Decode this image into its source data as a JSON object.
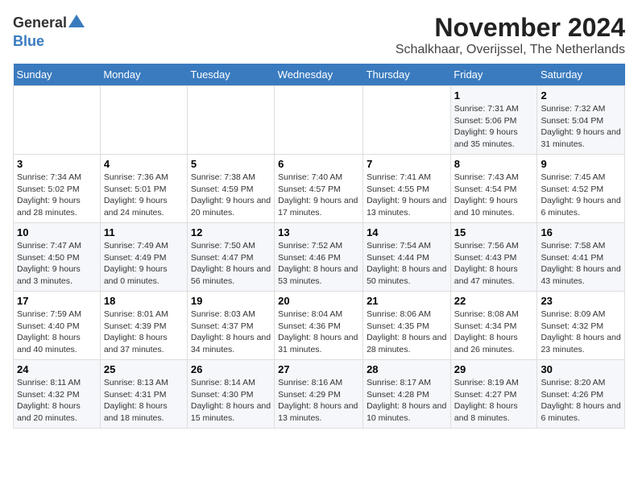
{
  "logo": {
    "general": "General",
    "blue": "Blue"
  },
  "title": "November 2024",
  "subtitle": "Schalkhaar, Overijssel, The Netherlands",
  "days_of_week": [
    "Sunday",
    "Monday",
    "Tuesday",
    "Wednesday",
    "Thursday",
    "Friday",
    "Saturday"
  ],
  "weeks": [
    [
      {
        "day": "",
        "info": ""
      },
      {
        "day": "",
        "info": ""
      },
      {
        "day": "",
        "info": ""
      },
      {
        "day": "",
        "info": ""
      },
      {
        "day": "",
        "info": ""
      },
      {
        "day": "1",
        "info": "Sunrise: 7:31 AM\nSunset: 5:06 PM\nDaylight: 9 hours and 35 minutes."
      },
      {
        "day": "2",
        "info": "Sunrise: 7:32 AM\nSunset: 5:04 PM\nDaylight: 9 hours and 31 minutes."
      }
    ],
    [
      {
        "day": "3",
        "info": "Sunrise: 7:34 AM\nSunset: 5:02 PM\nDaylight: 9 hours and 28 minutes."
      },
      {
        "day": "4",
        "info": "Sunrise: 7:36 AM\nSunset: 5:01 PM\nDaylight: 9 hours and 24 minutes."
      },
      {
        "day": "5",
        "info": "Sunrise: 7:38 AM\nSunset: 4:59 PM\nDaylight: 9 hours and 20 minutes."
      },
      {
        "day": "6",
        "info": "Sunrise: 7:40 AM\nSunset: 4:57 PM\nDaylight: 9 hours and 17 minutes."
      },
      {
        "day": "7",
        "info": "Sunrise: 7:41 AM\nSunset: 4:55 PM\nDaylight: 9 hours and 13 minutes."
      },
      {
        "day": "8",
        "info": "Sunrise: 7:43 AM\nSunset: 4:54 PM\nDaylight: 9 hours and 10 minutes."
      },
      {
        "day": "9",
        "info": "Sunrise: 7:45 AM\nSunset: 4:52 PM\nDaylight: 9 hours and 6 minutes."
      }
    ],
    [
      {
        "day": "10",
        "info": "Sunrise: 7:47 AM\nSunset: 4:50 PM\nDaylight: 9 hours and 3 minutes."
      },
      {
        "day": "11",
        "info": "Sunrise: 7:49 AM\nSunset: 4:49 PM\nDaylight: 9 hours and 0 minutes."
      },
      {
        "day": "12",
        "info": "Sunrise: 7:50 AM\nSunset: 4:47 PM\nDaylight: 8 hours and 56 minutes."
      },
      {
        "day": "13",
        "info": "Sunrise: 7:52 AM\nSunset: 4:46 PM\nDaylight: 8 hours and 53 minutes."
      },
      {
        "day": "14",
        "info": "Sunrise: 7:54 AM\nSunset: 4:44 PM\nDaylight: 8 hours and 50 minutes."
      },
      {
        "day": "15",
        "info": "Sunrise: 7:56 AM\nSunset: 4:43 PM\nDaylight: 8 hours and 47 minutes."
      },
      {
        "day": "16",
        "info": "Sunrise: 7:58 AM\nSunset: 4:41 PM\nDaylight: 8 hours and 43 minutes."
      }
    ],
    [
      {
        "day": "17",
        "info": "Sunrise: 7:59 AM\nSunset: 4:40 PM\nDaylight: 8 hours and 40 minutes."
      },
      {
        "day": "18",
        "info": "Sunrise: 8:01 AM\nSunset: 4:39 PM\nDaylight: 8 hours and 37 minutes."
      },
      {
        "day": "19",
        "info": "Sunrise: 8:03 AM\nSunset: 4:37 PM\nDaylight: 8 hours and 34 minutes."
      },
      {
        "day": "20",
        "info": "Sunrise: 8:04 AM\nSunset: 4:36 PM\nDaylight: 8 hours and 31 minutes."
      },
      {
        "day": "21",
        "info": "Sunrise: 8:06 AM\nSunset: 4:35 PM\nDaylight: 8 hours and 28 minutes."
      },
      {
        "day": "22",
        "info": "Sunrise: 8:08 AM\nSunset: 4:34 PM\nDaylight: 8 hours and 26 minutes."
      },
      {
        "day": "23",
        "info": "Sunrise: 8:09 AM\nSunset: 4:32 PM\nDaylight: 8 hours and 23 minutes."
      }
    ],
    [
      {
        "day": "24",
        "info": "Sunrise: 8:11 AM\nSunset: 4:32 PM\nDaylight: 8 hours and 20 minutes."
      },
      {
        "day": "25",
        "info": "Sunrise: 8:13 AM\nSunset: 4:31 PM\nDaylight: 8 hours and 18 minutes."
      },
      {
        "day": "26",
        "info": "Sunrise: 8:14 AM\nSunset: 4:30 PM\nDaylight: 8 hours and 15 minutes."
      },
      {
        "day": "27",
        "info": "Sunrise: 8:16 AM\nSunset: 4:29 PM\nDaylight: 8 hours and 13 minutes."
      },
      {
        "day": "28",
        "info": "Sunrise: 8:17 AM\nSunset: 4:28 PM\nDaylight: 8 hours and 10 minutes."
      },
      {
        "day": "29",
        "info": "Sunrise: 8:19 AM\nSunset: 4:27 PM\nDaylight: 8 hours and 8 minutes."
      },
      {
        "day": "30",
        "info": "Sunrise: 8:20 AM\nSunset: 4:26 PM\nDaylight: 8 hours and 6 minutes."
      }
    ]
  ]
}
